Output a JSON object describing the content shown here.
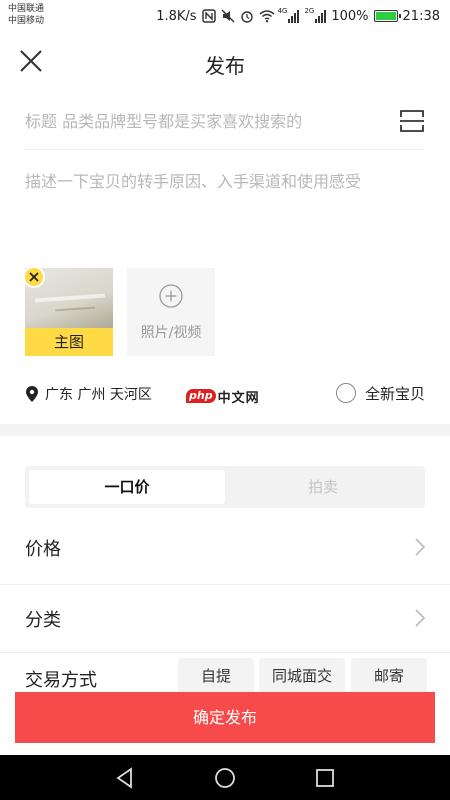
{
  "status_bar": {
    "carrier_1": "中国联通",
    "carrier_2": "中国移动",
    "net_speed": "1.8K/s",
    "network_1": "4G",
    "network_2": "2G",
    "battery": "100%",
    "battery_level": 1.0,
    "time": "21:38"
  },
  "header": {
    "title": "发布",
    "close_icon": "close-icon"
  },
  "form": {
    "title_placeholder": "标题 品类品牌型号都是买家喜欢搜索的",
    "description_placeholder": "描述一下宝贝的转手原因、入手渠道和使用感受",
    "main_photo_label": "主图",
    "add_photo_label": "照片/视频"
  },
  "location": {
    "text": "广东 广州 天河区"
  },
  "watermark": {
    "brand": "php",
    "text": "中文网"
  },
  "new_item": {
    "label": "全新宝贝",
    "checked": false
  },
  "price_modes": [
    {
      "label": "一口价",
      "active": true
    },
    {
      "label": "拍卖",
      "active": false
    }
  ],
  "rows": {
    "price": "价格",
    "category": "分类",
    "trade_method": "交易方式"
  },
  "trade_options": [
    "自提",
    "同城面交",
    "邮寄"
  ],
  "submit_label": "确定发布",
  "colors": {
    "accent_red": "#f74a4a",
    "highlight_yellow": "#ffda44"
  }
}
